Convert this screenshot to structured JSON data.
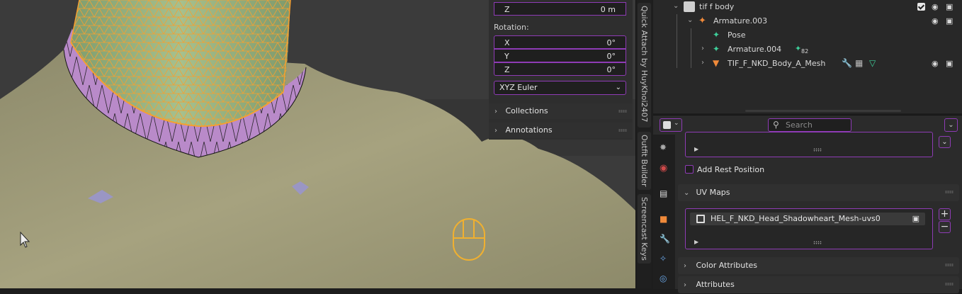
{
  "npanel": {
    "location_z": {
      "axis": "Z",
      "value": "0 m"
    },
    "rotation_label": "Rotation:",
    "rotation": [
      {
        "axis": "X",
        "value": "0°"
      },
      {
        "axis": "Y",
        "value": "0°"
      },
      {
        "axis": "Z",
        "value": "0°"
      }
    ],
    "rotation_mode": "XYZ Euler",
    "sections": [
      "Collections",
      "Annotations"
    ]
  },
  "sidebar_tabs": [
    "Quick Attach by HuyKhoi2407",
    "Outfit Builder",
    "Screencast Keys"
  ],
  "outliner": {
    "rows": [
      {
        "label": "tif f body",
        "icon": "collection-icon"
      },
      {
        "label": "Armature.003",
        "icon": "armature-icon"
      },
      {
        "label": "Pose",
        "icon": "pose-icon"
      },
      {
        "label": "Armature.004",
        "icon": "armature-icon",
        "badge": "82"
      },
      {
        "label": "TIF_F_NKD_Body_A_Mesh",
        "icon": "mesh-icon"
      }
    ]
  },
  "properties": {
    "search_placeholder": "Search",
    "add_rest_position": "Add Rest Position",
    "uv_maps_title": "UV Maps",
    "uv_map_name": "HEL_F_NKD_Head_Shadowheart_Mesh-uvs0",
    "add_button": "+",
    "remove_button": "−",
    "color_attributes": "Color Attributes",
    "attributes": "Attributes"
  },
  "colors": {
    "accent": "#8e3bb5",
    "mesh_wire": "#f5a030",
    "selected_faces": "#b98ac9",
    "skin": "#9e9a78"
  }
}
